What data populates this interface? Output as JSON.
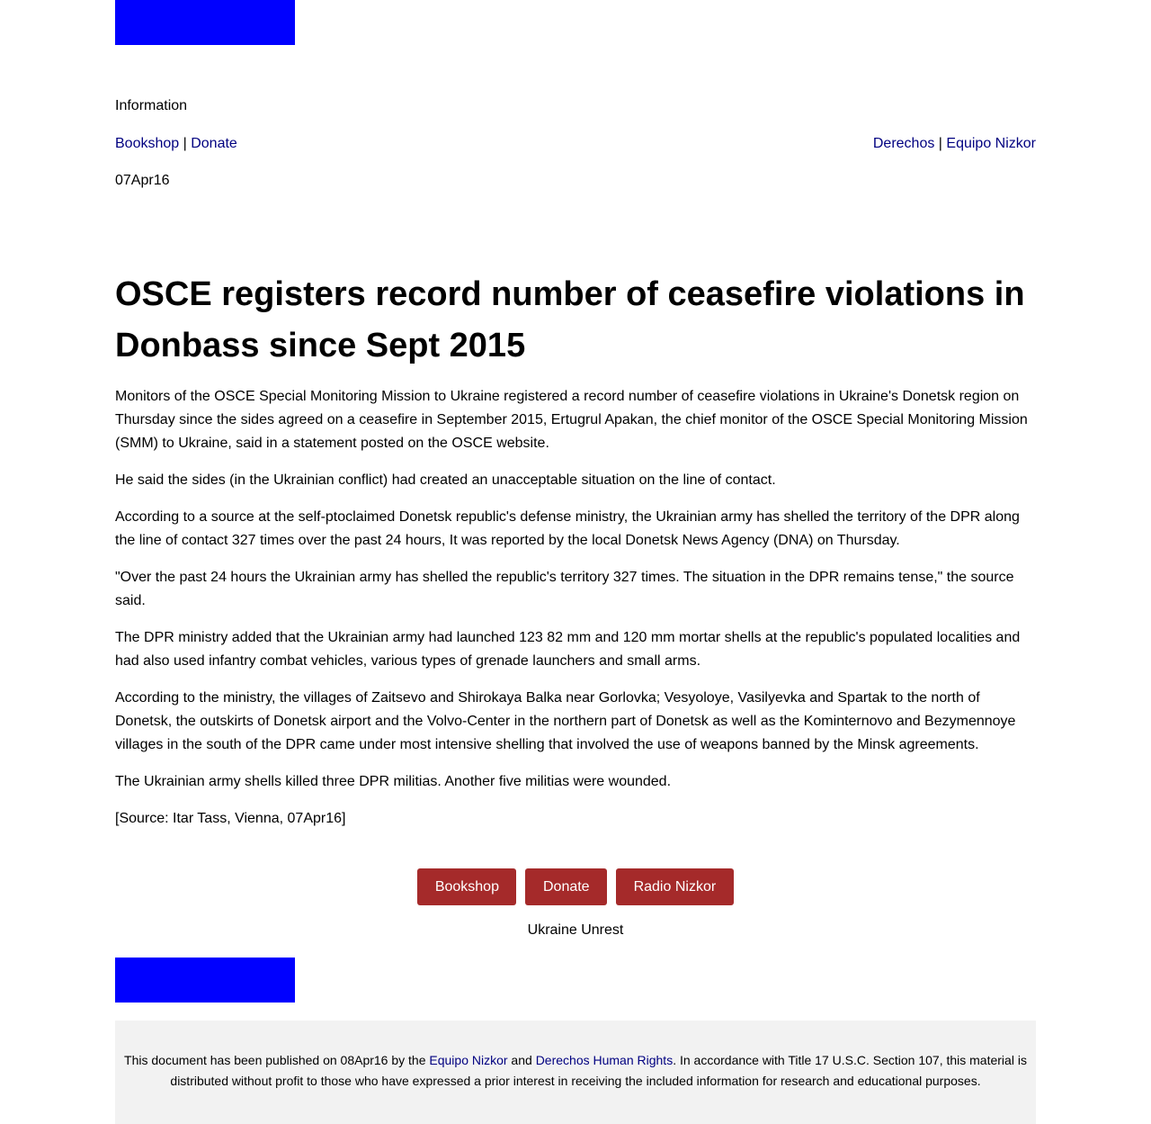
{
  "header": {
    "section": "Information",
    "nav_left": {
      "bookshop": "Bookshop",
      "sep": " | ",
      "donate": "Donate"
    },
    "nav_right": {
      "derechos": "Derechos",
      "sep": " | ",
      "equipo": "Equipo Nizkor"
    },
    "date": "07Apr16"
  },
  "article": {
    "title": "OSCE registers record number of ceasefire violations in Donbass since Sept 2015",
    "paragraphs": [
      "Monitors of the OSCE Special Monitoring Mission to Ukraine registered a record number of ceasefire violations in Ukraine's Donetsk region on Thursday since the sides agreed on a ceasefire in September 2015, Ertugrul Apakan, the chief monitor of the OSCE Special Monitoring Mission (SMM) to Ukraine, said in a statement posted on the OSCE website.",
      "He said the sides (in the Ukrainian conflict) had created an unacceptable situation on the line of contact.",
      "According to a source at the self-ptoclaimed Donetsk republic's defense ministry, the Ukrainian army has shelled the territory of the DPR along the line of contact 327 times over the past 24 hours, It was reported by the local Donetsk News Agency (DNA) on Thursday.",
      "\"Over the past 24 hours the Ukrainian army has shelled the republic's territory 327 times. The situation in the DPR remains tense,\" the source said.",
      "The DPR ministry added that the Ukrainian army had launched 123 82 mm and 120 mm mortar shells at the republic's populated localities and had also used infantry combat vehicles, various types of grenade launchers and small arms.",
      "According to the ministry, the villages of Zaitsevo and Shirokaya Balka near Gorlovka; Vesyoloye, Vasilyevka and Spartak to the north of Donetsk, the outskirts of Donetsk airport and the Volvo-Center in the northern part of Donetsk as well as the Kominternovo and Bezymennoye villages in the south of the DPR came under most intensive shelling that involved the use of weapons banned by the Minsk agreements.",
      "The Ukrainian army shells killed three DPR militias. Another five militias were wounded.",
      "[Source: Itar Tass, Vienna, 07Apr16]"
    ]
  },
  "buttons": {
    "bookshop": "Bookshop",
    "donate": "Donate",
    "radio": "Radio Nizkor"
  },
  "tag": "Ukraine Unrest",
  "footer": {
    "text1": "This document has been published on 08Apr16 by the ",
    "link1": "Equipo Nizkor",
    "text2": " and ",
    "link2": "Derechos Human Rights",
    "text3": ". In accordance with Title 17 U.S.C. Section 107, this material is distributed without profit to those who have expressed a prior interest in receiving the included information for research and educational purposes."
  },
  "colors": {
    "link": "#000080",
    "button_bg": "#a52a2a",
    "logo_block": "#0000ff",
    "footer_bg": "#f2f2f2"
  }
}
